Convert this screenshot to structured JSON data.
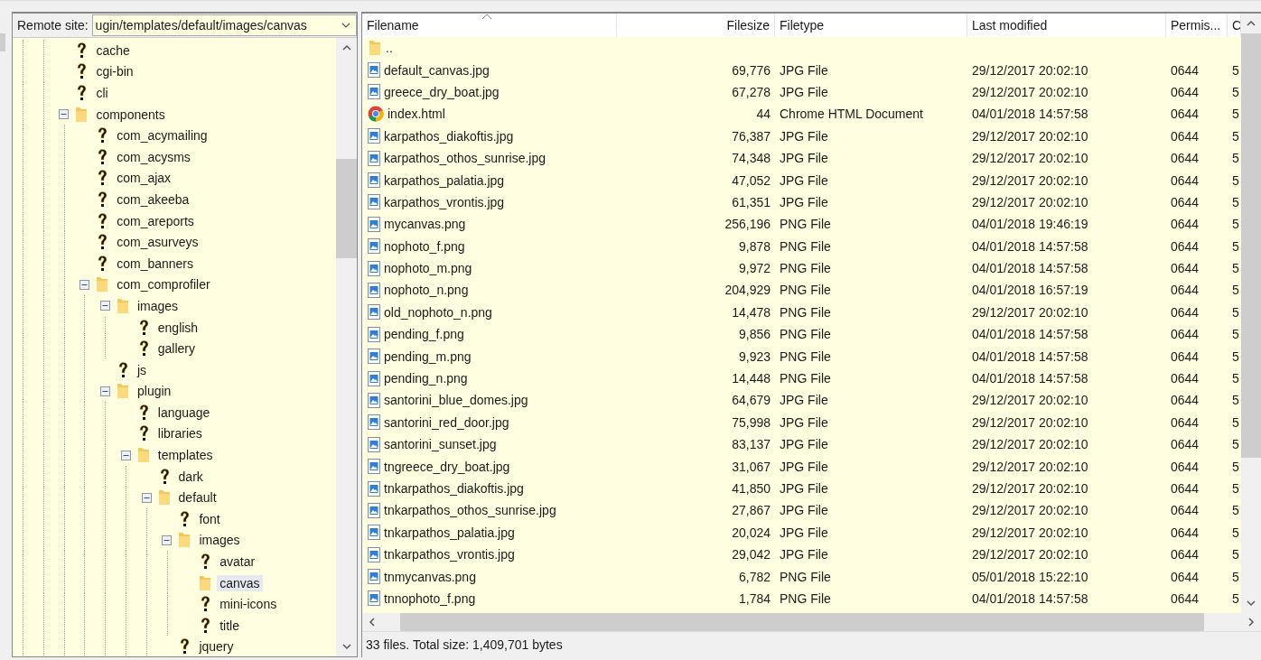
{
  "remote_site": {
    "label": "Remote site:",
    "path": "ugin/templates/default/images/canvas"
  },
  "tree": [
    {
      "name": "cache",
      "kind": "unknown",
      "selected": false
    },
    {
      "name": "cgi-bin",
      "kind": "unknown",
      "selected": false
    },
    {
      "name": "cli",
      "kind": "unknown",
      "selected": false
    },
    {
      "name": "components",
      "kind": "folder",
      "selected": false,
      "expanded": true,
      "children": [
        {
          "name": "com_acymailing",
          "kind": "unknown",
          "selected": false
        },
        {
          "name": "com_acysms",
          "kind": "unknown",
          "selected": false
        },
        {
          "name": "com_ajax",
          "kind": "unknown",
          "selected": false
        },
        {
          "name": "com_akeeba",
          "kind": "unknown",
          "selected": false
        },
        {
          "name": "com_areports",
          "kind": "unknown",
          "selected": false
        },
        {
          "name": "com_asurveys",
          "kind": "unknown",
          "selected": false
        },
        {
          "name": "com_banners",
          "kind": "unknown",
          "selected": false
        },
        {
          "name": "com_comprofiler",
          "kind": "folder",
          "selected": false,
          "expanded": true,
          "children": [
            {
              "name": "images",
              "kind": "folder",
              "selected": false,
              "expanded": true,
              "children": [
                {
                  "name": "english",
                  "kind": "unknown",
                  "selected": false
                },
                {
                  "name": "gallery",
                  "kind": "unknown",
                  "selected": false
                }
              ]
            },
            {
              "name": "js",
              "kind": "unknown",
              "selected": false
            },
            {
              "name": "plugin",
              "kind": "folder",
              "selected": false,
              "expanded": true,
              "children": [
                {
                  "name": "language",
                  "kind": "unknown",
                  "selected": false
                },
                {
                  "name": "libraries",
                  "kind": "unknown",
                  "selected": false
                },
                {
                  "name": "templates",
                  "kind": "folder",
                  "selected": false,
                  "expanded": true,
                  "children": [
                    {
                      "name": "dark",
                      "kind": "unknown",
                      "selected": false
                    },
                    {
                      "name": "default",
                      "kind": "folder",
                      "selected": false,
                      "expanded": true,
                      "children": [
                        {
                          "name": "font",
                          "kind": "unknown",
                          "selected": false
                        },
                        {
                          "name": "images",
                          "kind": "folder",
                          "selected": false,
                          "expanded": true,
                          "children": [
                            {
                              "name": "avatar",
                              "kind": "unknown",
                              "selected": false
                            },
                            {
                              "name": "canvas",
                              "kind": "folder",
                              "selected": true
                            },
                            {
                              "name": "mini-icons",
                              "kind": "unknown",
                              "selected": false
                            },
                            {
                              "name": "title",
                              "kind": "unknown",
                              "selected": false
                            }
                          ]
                        },
                        {
                          "name": "jquery",
                          "kind": "unknown",
                          "selected": false
                        }
                      ]
                    }
                  ]
                }
              ]
            }
          ]
        }
      ]
    }
  ],
  "file_list": {
    "columns": [
      "Filename",
      "Filesize",
      "Filetype",
      "Last modified",
      "Permis...",
      "C"
    ],
    "rows": [
      {
        "kind": "folder",
        "name": "..",
        "size": "",
        "type": "",
        "modified": "",
        "perms": "",
        "col6": ""
      },
      {
        "kind": "image",
        "name": "default_canvas.jpg",
        "size": "69,776",
        "type": "JPG File",
        "modified": "29/12/2017 20:02:10",
        "perms": "0644",
        "col6": "5"
      },
      {
        "kind": "image",
        "name": "greece_dry_boat.jpg",
        "size": "67,278",
        "type": "JPG File",
        "modified": "29/12/2017 20:02:10",
        "perms": "0644",
        "col6": "5"
      },
      {
        "kind": "browser",
        "name": "index.html",
        "size": "44",
        "type": "Chrome HTML Document",
        "modified": "04/01/2018 14:57:58",
        "perms": "0644",
        "col6": "5"
      },
      {
        "kind": "image",
        "name": "karpathos_diakoftis.jpg",
        "size": "76,387",
        "type": "JPG File",
        "modified": "29/12/2017 20:02:10",
        "perms": "0644",
        "col6": "5"
      },
      {
        "kind": "image",
        "name": "karpathos_othos_sunrise.jpg",
        "size": "74,348",
        "type": "JPG File",
        "modified": "29/12/2017 20:02:10",
        "perms": "0644",
        "col6": "5"
      },
      {
        "kind": "image",
        "name": "karpathos_palatia.jpg",
        "size": "47,052",
        "type": "JPG File",
        "modified": "29/12/2017 20:02:10",
        "perms": "0644",
        "col6": "5"
      },
      {
        "kind": "image",
        "name": "karpathos_vrontis.jpg",
        "size": "61,351",
        "type": "JPG File",
        "modified": "29/12/2017 20:02:10",
        "perms": "0644",
        "col6": "5"
      },
      {
        "kind": "image",
        "name": "mycanvas.png",
        "size": "256,196",
        "type": "PNG File",
        "modified": "04/01/2018 19:46:19",
        "perms": "0644",
        "col6": "5"
      },
      {
        "kind": "image",
        "name": "nophoto_f.png",
        "size": "9,878",
        "type": "PNG File",
        "modified": "04/01/2018 14:57:58",
        "perms": "0644",
        "col6": "5"
      },
      {
        "kind": "image",
        "name": "nophoto_m.png",
        "size": "9,972",
        "type": "PNG File",
        "modified": "04/01/2018 14:57:58",
        "perms": "0644",
        "col6": "5"
      },
      {
        "kind": "image",
        "name": "nophoto_n.png",
        "size": "204,929",
        "type": "PNG File",
        "modified": "04/01/2018 16:57:19",
        "perms": "0644",
        "col6": "5"
      },
      {
        "kind": "image",
        "name": "old_nophoto_n.png",
        "size": "14,478",
        "type": "PNG File",
        "modified": "29/12/2017 20:02:10",
        "perms": "0644",
        "col6": "5"
      },
      {
        "kind": "image",
        "name": "pending_f.png",
        "size": "9,856",
        "type": "PNG File",
        "modified": "04/01/2018 14:57:58",
        "perms": "0644",
        "col6": "5"
      },
      {
        "kind": "image",
        "name": "pending_m.png",
        "size": "9,923",
        "type": "PNG File",
        "modified": "04/01/2018 14:57:58",
        "perms": "0644",
        "col6": "5"
      },
      {
        "kind": "image",
        "name": "pending_n.png",
        "size": "14,448",
        "type": "PNG File",
        "modified": "04/01/2018 14:57:58",
        "perms": "0644",
        "col6": "5"
      },
      {
        "kind": "image",
        "name": "santorini_blue_domes.jpg",
        "size": "64,679",
        "type": "JPG File",
        "modified": "29/12/2017 20:02:10",
        "perms": "0644",
        "col6": "5"
      },
      {
        "kind": "image",
        "name": "santorini_red_door.jpg",
        "size": "75,998",
        "type": "JPG File",
        "modified": "29/12/2017 20:02:10",
        "perms": "0644",
        "col6": "5"
      },
      {
        "kind": "image",
        "name": "santorini_sunset.jpg",
        "size": "83,137",
        "type": "JPG File",
        "modified": "29/12/2017 20:02:10",
        "perms": "0644",
        "col6": "5"
      },
      {
        "kind": "image",
        "name": "tngreece_dry_boat.jpg",
        "size": "31,067",
        "type": "JPG File",
        "modified": "29/12/2017 20:02:10",
        "perms": "0644",
        "col6": "5"
      },
      {
        "kind": "image",
        "name": "tnkarpathos_diakoftis.jpg",
        "size": "41,850",
        "type": "JPG File",
        "modified": "29/12/2017 20:02:10",
        "perms": "0644",
        "col6": "5"
      },
      {
        "kind": "image",
        "name": "tnkarpathos_othos_sunrise.jpg",
        "size": "27,867",
        "type": "JPG File",
        "modified": "29/12/2017 20:02:10",
        "perms": "0644",
        "col6": "5"
      },
      {
        "kind": "image",
        "name": "tnkarpathos_palatia.jpg",
        "size": "20,024",
        "type": "JPG File",
        "modified": "29/12/2017 20:02:10",
        "perms": "0644",
        "col6": "5"
      },
      {
        "kind": "image",
        "name": "tnkarpathos_vrontis.jpg",
        "size": "29,042",
        "type": "JPG File",
        "modified": "29/12/2017 20:02:10",
        "perms": "0644",
        "col6": "5"
      },
      {
        "kind": "image",
        "name": "tnmycanvas.png",
        "size": "6,782",
        "type": "PNG File",
        "modified": "05/01/2018 15:22:10",
        "perms": "0644",
        "col6": "5"
      },
      {
        "kind": "image",
        "name": "tnnophoto_f.png",
        "size": "1,784",
        "type": "PNG File",
        "modified": "04/01/2018 14:57:58",
        "perms": "0644",
        "col6": "5"
      }
    ]
  },
  "status_bar": "33 files. Total size: 1,409,701 bytes"
}
